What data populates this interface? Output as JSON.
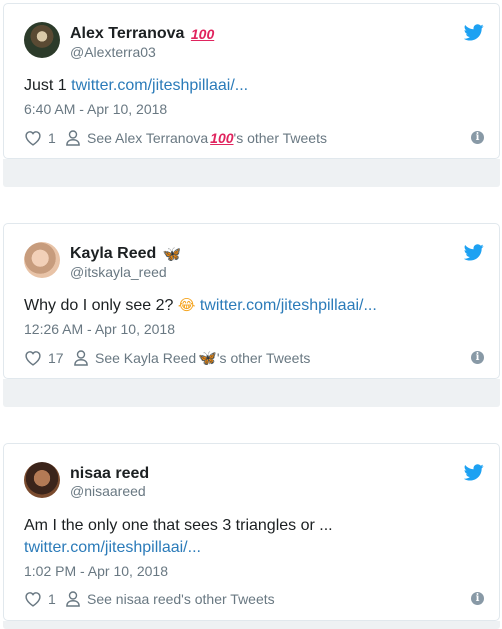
{
  "tweets": [
    {
      "name": "Alex Terranova",
      "name_emoji": "100",
      "handle": "@Alexterra03",
      "text_plain": "Just 1 ",
      "text_emoji": "",
      "link": "twitter.com/jiteshpillaai/...",
      "time": "6:40 AM - Apr 10, 2018",
      "likes": "1",
      "other_tweets_prefix": "See Alex Terranova ",
      "other_tweets_emoji": "100",
      "other_tweets_suffix": "'s other Tweets"
    },
    {
      "name": "Kayla Reed",
      "name_emoji": "🦋",
      "handle": "@itskayla_reed",
      "text_plain": "Why do I only see 2? ",
      "text_emoji": "😂",
      "link": "twitter.com/jiteshpillaai/...",
      "time": "12:26 AM - Apr 10, 2018",
      "likes": "17",
      "other_tweets_prefix": "See Kayla Reed ",
      "other_tweets_emoji": "🦋",
      "other_tweets_suffix": "'s other Tweets"
    },
    {
      "name": "nisaa reed",
      "handle": "@nisaareed",
      "text_plain": "Am I the only one that sees 3 triangles or ...",
      "link": "twitter.com/jiteshpillaai/...",
      "time": "1:02 PM - Apr 10, 2018",
      "likes": "1",
      "other_tweets": "See nisaa reed's other Tweets"
    }
  ],
  "icons": {
    "twitter_bird": "twitter-bird-icon",
    "like": "heart-icon",
    "profile": "person-icon",
    "info": "info-icon"
  },
  "colors": {
    "link": "#2b7bb9",
    "twitter_blue": "#1da1f2",
    "muted": "#697882"
  },
  "info_glyph": "i"
}
